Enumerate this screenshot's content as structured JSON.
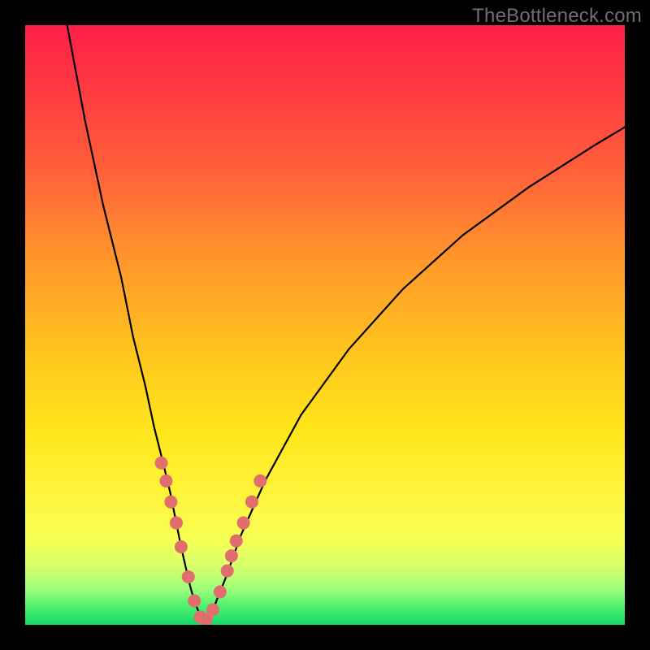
{
  "watermark": "TheBottleneck.com",
  "colors": {
    "gradient_top": "#ff1f4a",
    "gradient_mid1": "#ff9a2a",
    "gradient_mid2": "#ffe41a",
    "gradient_bottom": "#14d96a",
    "curve": "#000000",
    "dots": "#e26d6d",
    "background": "#000000"
  },
  "chart_data": {
    "type": "line",
    "title": "",
    "xlabel": "",
    "ylabel": "",
    "xlim": [
      0,
      100
    ],
    "ylim": [
      0,
      100
    ],
    "series": [
      {
        "name": "left-branch",
        "x": [
          7,
          10,
          13,
          16,
          18,
          20,
          21.5,
          23,
          24.2,
          25.2,
          26,
          26.8,
          27.5,
          28.2,
          29,
          30
        ],
        "values": [
          100,
          84,
          70,
          58,
          48,
          40,
          33,
          27,
          22,
          17,
          13,
          9.5,
          6.5,
          4,
          2,
          0.5
        ]
      },
      {
        "name": "right-branch",
        "x": [
          30,
          31.5,
          33.5,
          36,
          40,
          46,
          54,
          63,
          73,
          84,
          95,
          100
        ],
        "values": [
          0.5,
          3,
          8,
          15,
          24,
          35,
          46,
          56,
          65,
          73,
          80,
          83
        ]
      }
    ],
    "markers": {
      "name": "highlighted-points",
      "x": [
        22.7,
        23.5,
        24.3,
        25.2,
        26.0,
        27.2,
        28.2,
        29.2,
        30.2,
        31.3,
        32.5,
        33.7,
        34.4,
        35.2,
        36.4,
        37.8,
        39.2
      ],
      "values": [
        27,
        24,
        20.5,
        17,
        13,
        8,
        4,
        1.3,
        0.9,
        2.5,
        5.5,
        9,
        11.5,
        14,
        17,
        20.5,
        24
      ],
      "radius": 8
    }
  }
}
